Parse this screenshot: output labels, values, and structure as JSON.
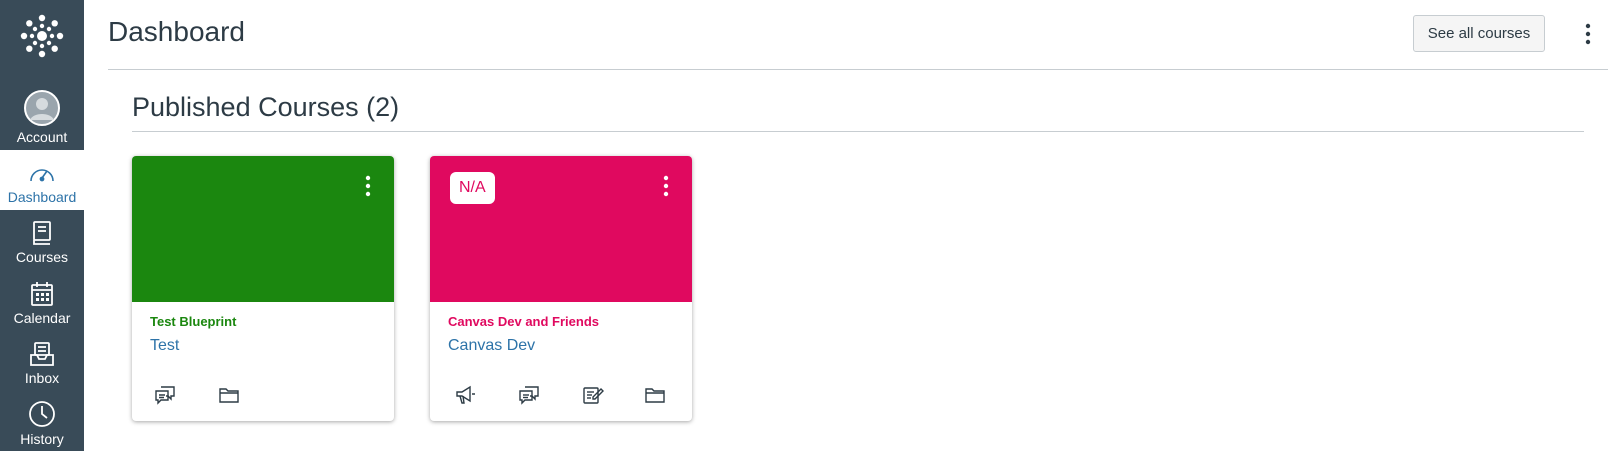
{
  "nav": {
    "items": [
      {
        "label": "Account",
        "icon": "avatar"
      },
      {
        "label": "Dashboard",
        "icon": "dashboard-icon"
      },
      {
        "label": "Courses",
        "icon": "book-icon"
      },
      {
        "label": "Calendar",
        "icon": "calendar-icon"
      },
      {
        "label": "Inbox",
        "icon": "inbox-icon"
      },
      {
        "label": "History",
        "icon": "clock-icon"
      }
    ]
  },
  "header": {
    "title": "Dashboard",
    "see_all_label": "See all courses"
  },
  "section": {
    "title": "Published Courses (2)"
  },
  "cards": [
    {
      "title": "Test Blueprint",
      "subtitle": "Test",
      "color": "#1b870f",
      "badge": "",
      "icons": [
        "discussion-icon",
        "folder-icon"
      ]
    },
    {
      "title": "Canvas Dev and Friends",
      "subtitle": "Canvas Dev",
      "color": "#e0095f",
      "badge": "N/A",
      "icons": [
        "announcement-icon",
        "discussion-icon",
        "assignment-icon",
        "folder-icon"
      ]
    }
  ],
  "colors": {
    "nav_bg": "#394b58",
    "active_link": "#2d73a8"
  }
}
